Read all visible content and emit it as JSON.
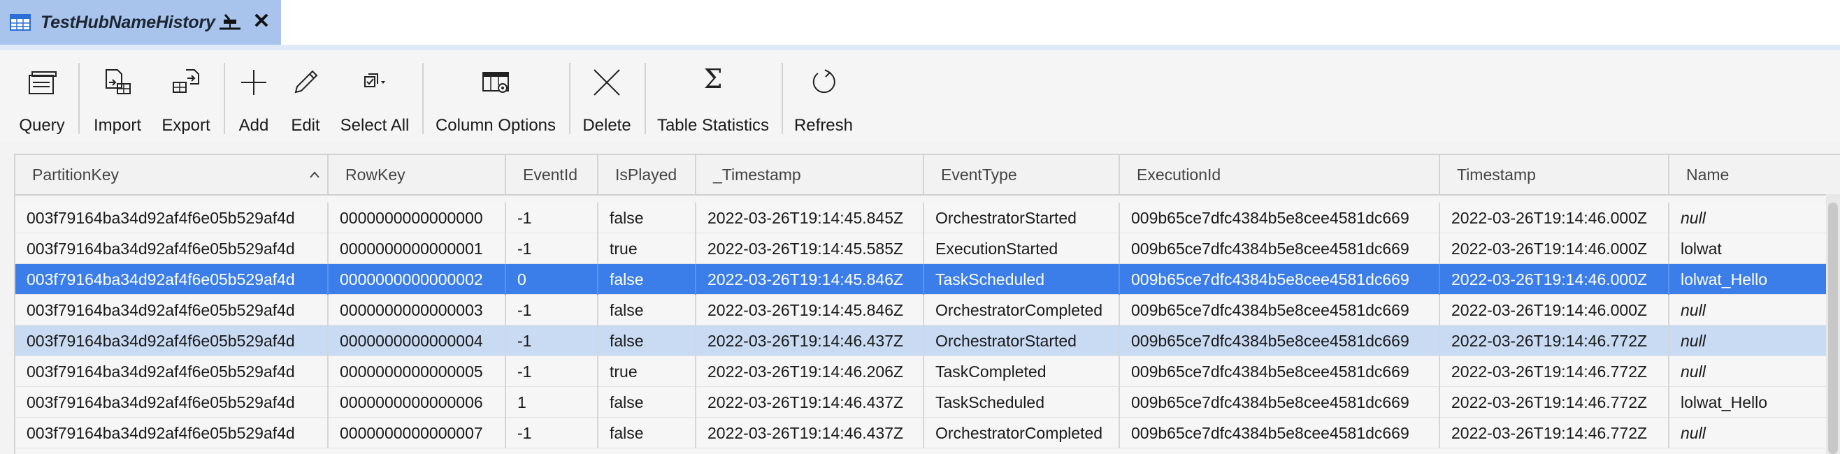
{
  "tab": {
    "title": "TestHubNameHistory",
    "close_glyph": "✕"
  },
  "toolbar": {
    "query": "Query",
    "import": "Import",
    "export": "Export",
    "add": "Add",
    "edit": "Edit",
    "select_all": "Select All",
    "column_options": "Column Options",
    "delete": "Delete",
    "table_statistics": "Table Statistics",
    "refresh": "Refresh",
    "sigma": "Σ"
  },
  "table": {
    "columns": [
      "PartitionKey",
      "RowKey",
      "EventId",
      "IsPlayed",
      "_Timestamp",
      "EventType",
      "ExecutionId",
      "Timestamp",
      "Name"
    ],
    "sorted_column": "PartitionKey",
    "sort_direction": "ascending",
    "selected_row": 2,
    "highlighted_row": 4,
    "rows": [
      [
        "003f79164ba34d92af4f6e05b529af4d",
        "0000000000000000",
        "-1",
        "false",
        "2022-03-26T19:14:45.845Z",
        "OrchestratorStarted",
        "009b65ce7dfc4384b5e8cee4581dc669",
        "2022-03-26T19:14:46.000Z",
        "null"
      ],
      [
        "003f79164ba34d92af4f6e05b529af4d",
        "0000000000000001",
        "-1",
        "true",
        "2022-03-26T19:14:45.585Z",
        "ExecutionStarted",
        "009b65ce7dfc4384b5e8cee4581dc669",
        "2022-03-26T19:14:46.000Z",
        "lolwat"
      ],
      [
        "003f79164ba34d92af4f6e05b529af4d",
        "0000000000000002",
        "0",
        "false",
        "2022-03-26T19:14:45.846Z",
        "TaskScheduled",
        "009b65ce7dfc4384b5e8cee4581dc669",
        "2022-03-26T19:14:46.000Z",
        "lolwat_Hello"
      ],
      [
        "003f79164ba34d92af4f6e05b529af4d",
        "0000000000000003",
        "-1",
        "false",
        "2022-03-26T19:14:45.846Z",
        "OrchestratorCompleted",
        "009b65ce7dfc4384b5e8cee4581dc669",
        "2022-03-26T19:14:46.000Z",
        "null"
      ],
      [
        "003f79164ba34d92af4f6e05b529af4d",
        "0000000000000004",
        "-1",
        "false",
        "2022-03-26T19:14:46.437Z",
        "OrchestratorStarted",
        "009b65ce7dfc4384b5e8cee4581dc669",
        "2022-03-26T19:14:46.772Z",
        "null"
      ],
      [
        "003f79164ba34d92af4f6e05b529af4d",
        "0000000000000005",
        "-1",
        "true",
        "2022-03-26T19:14:46.206Z",
        "TaskCompleted",
        "009b65ce7dfc4384b5e8cee4581dc669",
        "2022-03-26T19:14:46.772Z",
        "null"
      ],
      [
        "003f79164ba34d92af4f6e05b529af4d",
        "0000000000000006",
        "1",
        "false",
        "2022-03-26T19:14:46.437Z",
        "TaskScheduled",
        "009b65ce7dfc4384b5e8cee4581dc669",
        "2022-03-26T19:14:46.772Z",
        "lolwat_Hello"
      ],
      [
        "003f79164ba34d92af4f6e05b529af4d",
        "0000000000000007",
        "-1",
        "false",
        "2022-03-26T19:14:46.437Z",
        "OrchestratorCompleted",
        "009b65ce7dfc4384b5e8cee4581dc669",
        "2022-03-26T19:14:46.772Z",
        "null"
      ]
    ]
  },
  "colors": {
    "tab_active": "#a9c4ec",
    "row_selected": "#3b7de9",
    "row_highlight": "#c9dbf3"
  },
  "icons": [
    "table-icon",
    "pin-icon",
    "close-icon",
    "query-icon",
    "import-icon",
    "export-icon",
    "add-icon",
    "edit-icon",
    "select-all-icon",
    "column-options-icon",
    "delete-icon",
    "sigma-icon",
    "refresh-icon",
    "sort-ascending-icon"
  ]
}
